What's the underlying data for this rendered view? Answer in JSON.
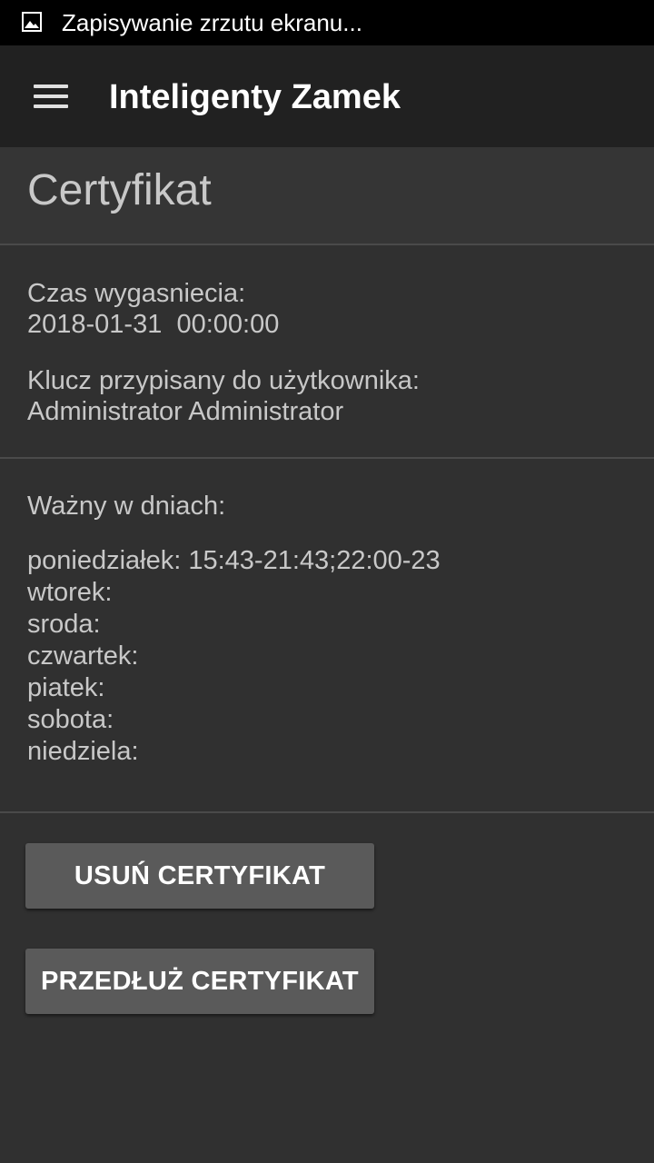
{
  "status_bar": {
    "icon": "image-icon",
    "text": "Zapisywanie zrzutu ekranu..."
  },
  "app_bar": {
    "menu_icon": "hamburger-menu-icon",
    "title": "Inteligenty Zamek"
  },
  "page": {
    "title": "Certyfikat"
  },
  "expiry": {
    "label": "Czas wygasniecia:",
    "value": "2018-01-31  00:00:00"
  },
  "user": {
    "label": "Klucz przypisany do użytkownika:",
    "value": "Administrator Administrator"
  },
  "schedule": {
    "label": "Ważny w dniach:",
    "days": [
      "poniedziałek: 15:43-21:43;22:00-23",
      "wtorek:",
      "sroda:",
      "czwartek:",
      "piatek:",
      "sobota:",
      "niedziela:"
    ]
  },
  "buttons": {
    "delete_label": "USUŃ CERTYFIKAT",
    "extend_label": "PRZEDŁUŻ CERTYFIKAT"
  },
  "colors": {
    "background": "#303030",
    "app_bar": "#212121",
    "button": "#5a5a5a",
    "text": "#c8c8c8"
  }
}
